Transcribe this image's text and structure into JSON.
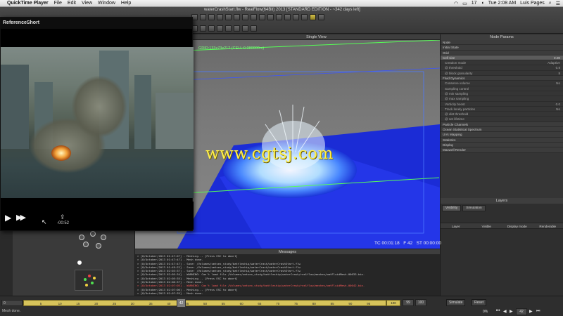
{
  "menubar": {
    "app": "QuickTime Player",
    "items": [
      "File",
      "Edit",
      "View",
      "Window",
      "Help"
    ],
    "battery": "17",
    "time": "Tue 2:08 AM",
    "user": "Luis Pages"
  },
  "realflow": {
    "title": "waterCrashStart.flw - RealFlow(64Bit) 2013 [STANDARD EDITION - ~342 days left]"
  },
  "quicktime": {
    "title": "ReferenceShort",
    "time_remaining": "-00:52"
  },
  "viewport": {
    "header": "Single View",
    "grid_info": "GRID:133x73x212 (CELL:0.080000m)",
    "tc": "TC 00:01:18",
    "frame": "F 42",
    "st": "ST 00:00:00",
    "watermark": "www.cgtsj.com"
  },
  "messages": {
    "header": "Messages",
    "lines": [
      {
        "text": "> [8/October/2013 01:47:0?] - Meshing... [Press ESC to abort]",
        "warn": false
      },
      {
        "text": "> [8/October/2013 01:47:4?] - Mesh done.",
        "warn": false
      },
      {
        "text": "> [8/October/2013 01:47:47] - Save: /Volumes/smtsex_study/battleship/waterCrash/waterCrashStart.flw",
        "warn": false
      },
      {
        "text": "> [8/October/2013 01:49:22] - Save: /Volumes/smtsex_study/battleship/waterCrash/waterCrashStart.flw",
        "warn": false
      },
      {
        "text": "> [8/October/2013 02:03:37] - Save: /Volumes/smtsex_study/battleship/waterCrash/waterCrashStart.flw",
        "warn": false
      },
      {
        "text": "> [8/October/2013 02:05:34] - WARNING: Can't load file /Volumes/smtsex_study/battleship/waterCrash/realflow/meshes/omtFluidMesh.00033.bin.",
        "warn": false
      },
      {
        "text": "> [8/October/2013 02:05:35] - Meshing... [Press ESC to abort]",
        "warn": false
      },
      {
        "text": "> [8/October/2013 02:06:3?] - Mesh done.",
        "warn": false
      },
      {
        "text": "> [8/October/2013 02:07:05] - WARNING: Can't load file /Volumes/smtsex_study/battleship/waterCrash/realflow/meshes/omtFluidMesh.00042.bin.",
        "warn": true
      },
      {
        "text": "> [8/October/2013 02:07:06] - Meshing... [Press ESC to abort]",
        "warn": false
      },
      {
        "text": "> [8/October/2013 02:07:35] - Mesh done.",
        "warn": false
      }
    ]
  },
  "node_params": {
    "header": "Node Params",
    "rows": [
      {
        "label": "Node",
        "value": "",
        "kind": "sec"
      },
      {
        "label": "Initial State",
        "value": "",
        "kind": "sec"
      },
      {
        "label": "Grid",
        "value": "",
        "kind": "sec"
      },
      {
        "label": "Cell size",
        "value": "0.08",
        "kind": "hl"
      },
      {
        "label": "Creation mode",
        "value": "Adaptive",
        "kind": "sub"
      },
      {
        "label": "@ threshold",
        "value": "0.8",
        "kind": "sub"
      },
      {
        "label": "@ block granularity",
        "value": "8",
        "kind": "sub"
      },
      {
        "label": "Fluid Dynamics",
        "value": "",
        "kind": "sec"
      },
      {
        "label": "Conserve volume",
        "value": "No",
        "kind": "sub"
      },
      {
        "label": "Sampling control",
        "value": "",
        "kind": "sub"
      },
      {
        "label": "@ min sampling",
        "value": "",
        "kind": "sub"
      },
      {
        "label": "@ max sampling",
        "value": "",
        "kind": "sub"
      },
      {
        "label": "Vorticity boost",
        "value": "0.0",
        "kind": "sub"
      },
      {
        "label": "Track lonely particles",
        "value": "No",
        "kind": "sub"
      },
      {
        "label": "@ dist threshold",
        "value": "",
        "kind": "sub"
      },
      {
        "label": "@ set lifetime",
        "value": "",
        "kind": "sub"
      },
      {
        "label": "Particle Channels",
        "value": "",
        "kind": "sec"
      },
      {
        "label": "Ocean Statistical Spectrum",
        "value": "",
        "kind": "sec"
      },
      {
        "label": "UVs Mapping",
        "value": "",
        "kind": "sec"
      },
      {
        "label": "Statistics",
        "value": "",
        "kind": "sec"
      },
      {
        "label": "Display",
        "value": "",
        "kind": "sec"
      },
      {
        "label": "Maxwell Render",
        "value": "",
        "kind": "sec"
      }
    ]
  },
  "layers": {
    "header": "Layers",
    "tabs": [
      "Visibility",
      "Simulation"
    ],
    "columns": [
      "Layer",
      "Visible",
      "Display mode",
      "Renderable"
    ]
  },
  "timeline": {
    "start": "0",
    "ticks": [
      "5",
      "10",
      "15",
      "20",
      "25",
      "30",
      "35",
      "40",
      "45",
      "50",
      "55",
      "60",
      "65",
      "70",
      "75",
      "80",
      "85",
      "90",
      "95"
    ],
    "current": "42",
    "tail": "100",
    "end_a": "99",
    "end_b": "100",
    "status": "Mesh done.",
    "simulate_label": "Simulate",
    "reset_label": "Reset",
    "fps_label": "0%",
    "frame_field": "42"
  }
}
